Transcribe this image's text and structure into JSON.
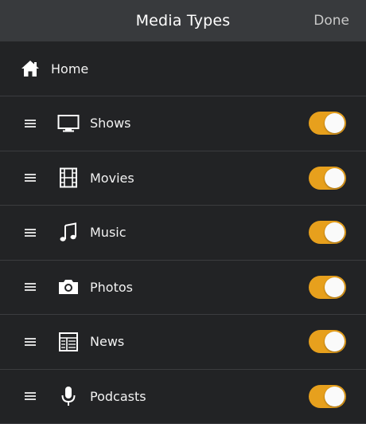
{
  "navbar": {
    "title": "Media Types",
    "done_label": "Done"
  },
  "home": {
    "label": "Home",
    "icon": "home-icon"
  },
  "media_types": [
    {
      "label": "Shows",
      "icon": "tv-icon",
      "enabled": true
    },
    {
      "label": "Movies",
      "icon": "film-icon",
      "enabled": true
    },
    {
      "label": "Music",
      "icon": "music-note-icon",
      "enabled": true
    },
    {
      "label": "Photos",
      "icon": "camera-icon",
      "enabled": true
    },
    {
      "label": "News",
      "icon": "newspaper-icon",
      "enabled": true
    },
    {
      "label": "Podcasts",
      "icon": "microphone-icon",
      "enabled": true
    }
  ],
  "colors": {
    "toggle_on": "#e7a01d",
    "navbar_bg": "#383a3d",
    "row_bg": "#222325",
    "separator": "#3b3c3f"
  }
}
